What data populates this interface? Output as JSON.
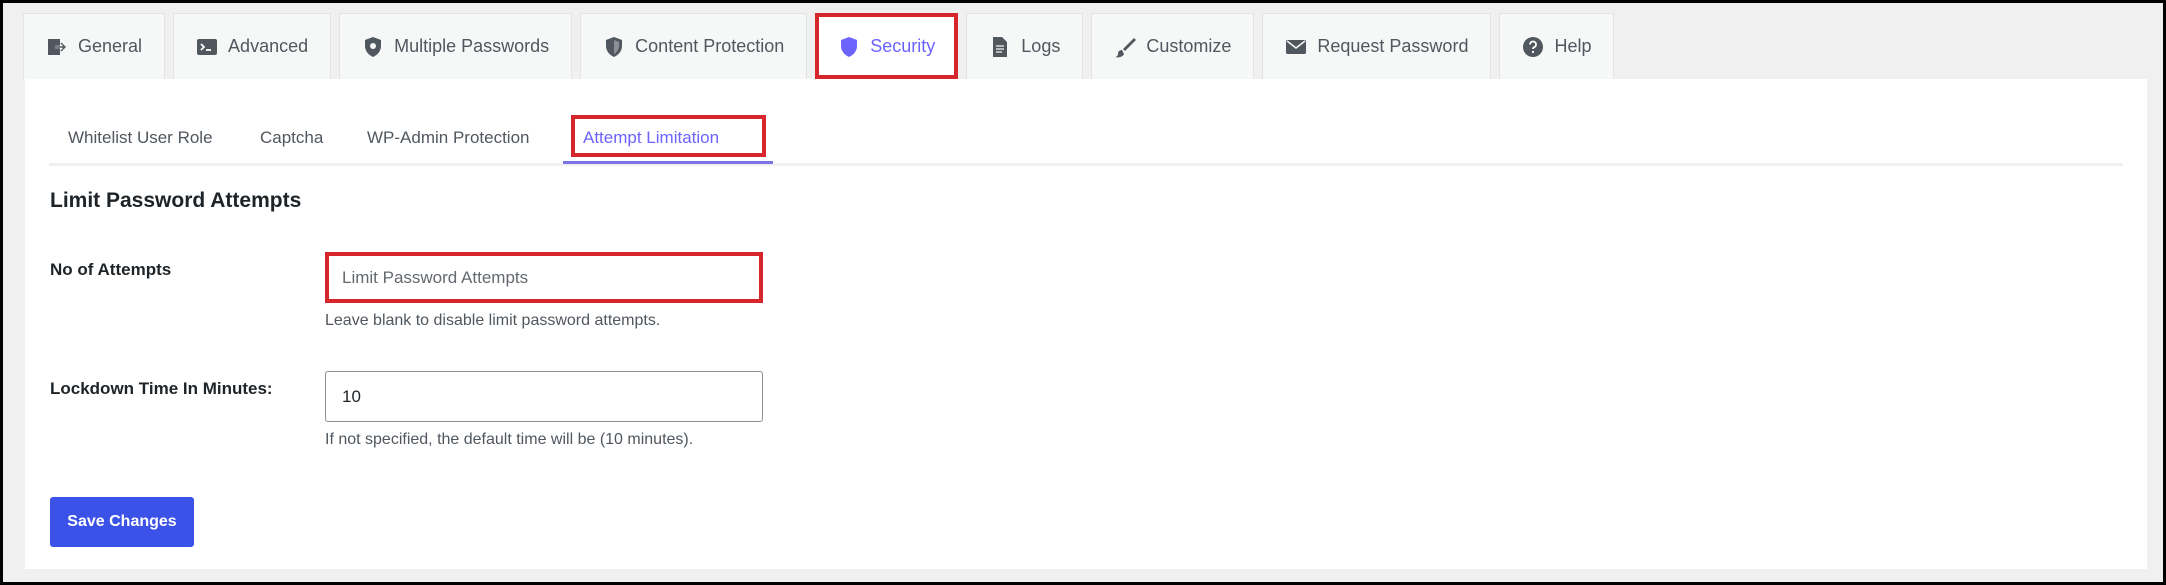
{
  "top_tabs": [
    {
      "label": "General",
      "icon": "exit-icon"
    },
    {
      "label": "Advanced",
      "icon": "terminal-icon"
    },
    {
      "label": "Multiple Passwords",
      "icon": "shield-icon"
    },
    {
      "label": "Content Protection",
      "icon": "shield-half-icon"
    },
    {
      "label": "Security",
      "icon": "shield-icon",
      "active": true,
      "highlighted": true
    },
    {
      "label": "Logs",
      "icon": "document-icon"
    },
    {
      "label": "Customize",
      "icon": "brush-icon"
    },
    {
      "label": "Request Password",
      "icon": "mail-icon"
    },
    {
      "label": "Help",
      "icon": "help-icon"
    }
  ],
  "sub_tabs": [
    {
      "label": "Whitelist User Role"
    },
    {
      "label": "Captcha"
    },
    {
      "label": "WP-Admin Protection"
    },
    {
      "label": "Attempt Limitation",
      "active": true,
      "highlighted": true
    }
  ],
  "section": {
    "title": "Limit Password Attempts"
  },
  "fields": {
    "attempts": {
      "label": "No of Attempts",
      "value": "",
      "placeholder": "Limit Password Attempts",
      "help": "Leave blank to disable limit password attempts."
    },
    "lockdown": {
      "label": "Lockdown Time In Minutes:",
      "value": "10",
      "placeholder": "",
      "help": "If not specified, the default time will be (10 minutes)."
    }
  },
  "actions": {
    "save_label": "Save Changes"
  },
  "colors": {
    "accent": "#6c63ff",
    "highlight": "#d6262c",
    "primary_button": "#3b52e8"
  }
}
